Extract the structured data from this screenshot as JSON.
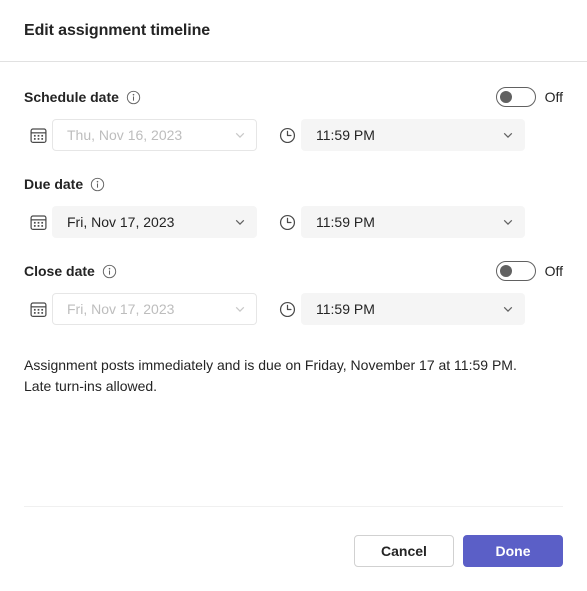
{
  "dialog": {
    "title": "Edit assignment timeline"
  },
  "fields": [
    {
      "label": "Schedule date",
      "info_icon": "info-icon",
      "has_toggle": true,
      "toggle_state": "Off",
      "toggle_on": false,
      "date_icon": "calendar-icon",
      "date_value": "Thu, Nov 16, 2023",
      "date_enabled": false,
      "time_icon": "clock-icon",
      "time_value": "11:59 PM",
      "time_enabled": true
    },
    {
      "label": "Due date",
      "info_icon": "info-icon",
      "has_toggle": false,
      "toggle_state": "",
      "toggle_on": false,
      "date_icon": "calendar-icon",
      "date_value": "Fri, Nov 17, 2023",
      "date_enabled": true,
      "time_icon": "clock-icon",
      "time_value": "11:59 PM",
      "time_enabled": true
    },
    {
      "label": "Close date",
      "info_icon": "info-icon",
      "has_toggle": true,
      "toggle_state": "Off",
      "toggle_on": false,
      "date_icon": "calendar-icon",
      "date_value": "Fri, Nov 17, 2023",
      "date_enabled": false,
      "time_icon": "clock-icon",
      "time_value": "11:59 PM",
      "time_enabled": true
    }
  ],
  "summary": "Assignment posts immediately and is due on Friday, November 17 at 11:59 PM. Late turn-ins allowed.",
  "footer": {
    "cancel_label": "Cancel",
    "done_label": "Done"
  },
  "colors": {
    "accent": "#5b5fc7",
    "text": "#242424",
    "field_background": "#f5f5f5",
    "disabled_text": "#bdbdbd",
    "border": "#e1e1e1"
  }
}
